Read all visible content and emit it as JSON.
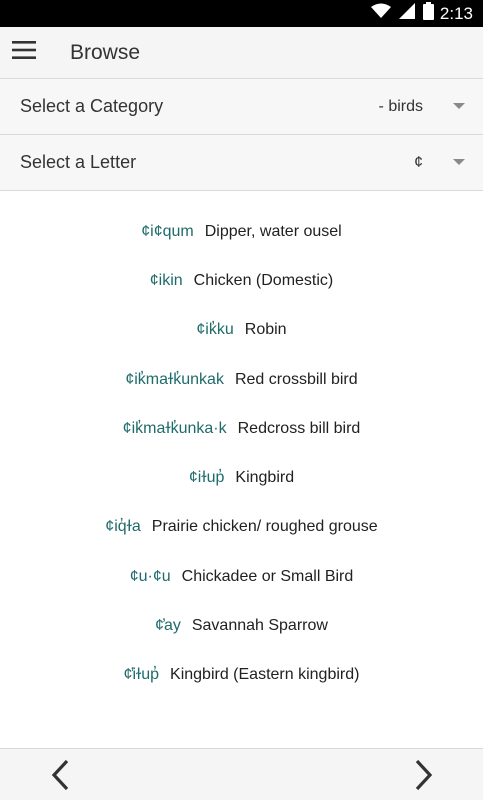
{
  "status_bar": {
    "time": "2:13",
    "icons": [
      "wifi-icon",
      "signal-icon",
      "battery-icon"
    ]
  },
  "app_bar": {
    "title": "Browse",
    "menu_icon": "hamburger-menu-icon"
  },
  "filters": {
    "category": {
      "label": "Select a Category",
      "value": "- birds"
    },
    "letter": {
      "label": "Select a Letter",
      "value": "¢"
    }
  },
  "entries": [
    {
      "term": "¢i¢qum",
      "definition": "Dipper, water ousel"
    },
    {
      "term": "¢ikin",
      "definition": "Chicken (Domestic)"
    },
    {
      "term": "¢ik̓ku",
      "definition": "Robin"
    },
    {
      "term": "¢ik̓maɫk̓unkak",
      "definition": "Red crossbill bird"
    },
    {
      "term": "¢ik̓maɫk̓unka·k",
      "definition": "Redcross bill bird"
    },
    {
      "term": "¢iɫup̓",
      "definition": "Kingbird"
    },
    {
      "term": "¢iq̓ɫa",
      "definition": "Prairie chicken/ roughed grouse"
    },
    {
      "term": "¢u·¢u",
      "definition": "Chickadee or Small Bird"
    },
    {
      "term": "¢̓ay",
      "definition": "Savannah Sparrow"
    },
    {
      "term": "¢̓iɫup̓",
      "definition": "Kingbird (Eastern kingbird)"
    }
  ],
  "navigation": {
    "prev_icon": "chevron-left-icon",
    "next_icon": "chevron-right-icon"
  },
  "colors": {
    "term": "#1f6b6b",
    "status_bar": "#000000",
    "app_bar": "#f5f5f5"
  }
}
